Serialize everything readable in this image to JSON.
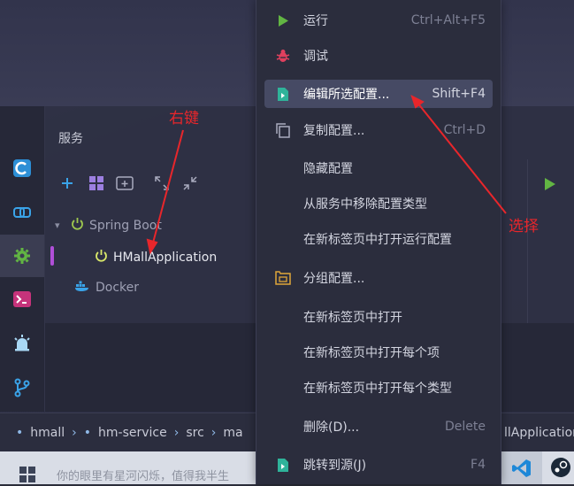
{
  "services_panel": {
    "title": "服务",
    "tree": {
      "spring_boot": "Spring Boot",
      "app": "HMallApplication",
      "docker": "Docker"
    }
  },
  "context_menu": {
    "items": [
      {
        "label": "运行",
        "shortcut": "Ctrl+Alt+F5"
      },
      {
        "label": "调试",
        "shortcut": ""
      },
      {
        "label": "编辑所选配置...",
        "shortcut": "Shift+F4"
      },
      {
        "label": "复制配置...",
        "shortcut": "Ctrl+D"
      },
      {
        "label": "隐藏配置",
        "shortcut": ""
      },
      {
        "label": "从服务中移除配置类型",
        "shortcut": ""
      },
      {
        "label": "在新标签页中打开运行配置",
        "shortcut": ""
      },
      {
        "label": "分组配置...",
        "shortcut": ""
      },
      {
        "label": "在新标签页中打开",
        "shortcut": ""
      },
      {
        "label": "在新标签页中打开每个项",
        "shortcut": ""
      },
      {
        "label": "在新标签页中打开每个类型",
        "shortcut": ""
      },
      {
        "label": "删除(D)...",
        "shortcut": "Delete"
      },
      {
        "label": "跳转到源(J)",
        "shortcut": "F4"
      }
    ]
  },
  "breadcrumb": {
    "items": [
      "hmall",
      "hm-service",
      "src",
      "ma"
    ],
    "right_text": "llApplication"
  },
  "annotations": {
    "right_click": "右键",
    "select": "选择"
  },
  "taskbar": {
    "text": "你的眼里有星河闪烁，值得我半生"
  },
  "colors": {
    "accent_purple": "#b04fd8",
    "highlight": "#464a64",
    "annotation_red": "#e8262b",
    "spring_green": "#9fc94f"
  }
}
